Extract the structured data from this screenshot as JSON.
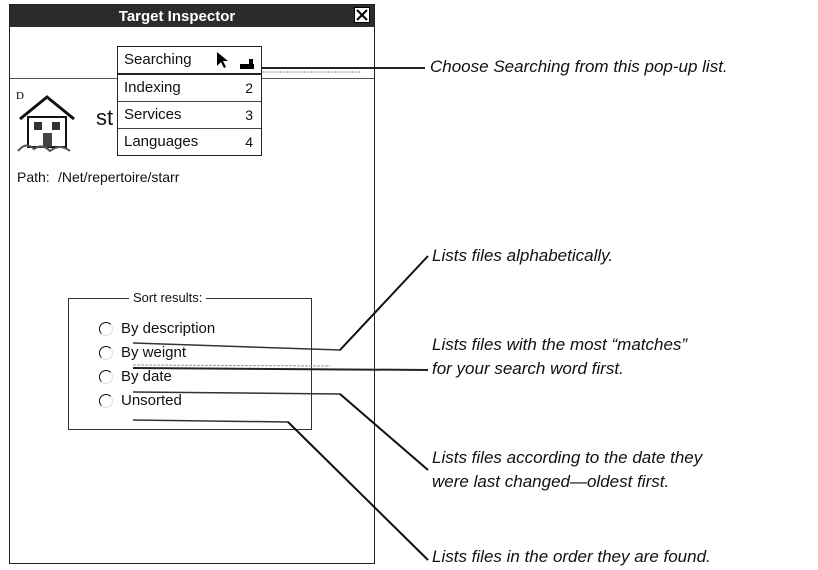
{
  "window": {
    "title": "Target Inspector"
  },
  "popup": {
    "items": [
      {
        "label": "Searching",
        "key": ""
      },
      {
        "label": "Indexing",
        "key": "2"
      },
      {
        "label": "Services",
        "key": "3"
      },
      {
        "label": "Languages",
        "key": "4"
      }
    ]
  },
  "file": {
    "name_visible": "st",
    "path_label": "Path:",
    "path_value": "/Net/repertoire/starr"
  },
  "sort": {
    "legend": "Sort results:",
    "options": [
      {
        "label": "By description"
      },
      {
        "label": "By weignt"
      },
      {
        "label": "By date"
      },
      {
        "label": "Unsorted"
      }
    ]
  },
  "callouts": {
    "popup": "Choose Searching from this pop-up list.",
    "alpha": "Lists files alphabetically.",
    "weight_1": "Lists files with the most “matches”",
    "weight_2": "for your search word first.",
    "date_1": "Lists files according to the date they",
    "date_2": "were last changed—oldest first.",
    "unsorted": "Lists files in the order they are found."
  },
  "icons": {
    "close": "close-icon",
    "cursor": "arrow-cursor-icon",
    "keyboard": "keyboard-icon",
    "house": "house-icon"
  }
}
